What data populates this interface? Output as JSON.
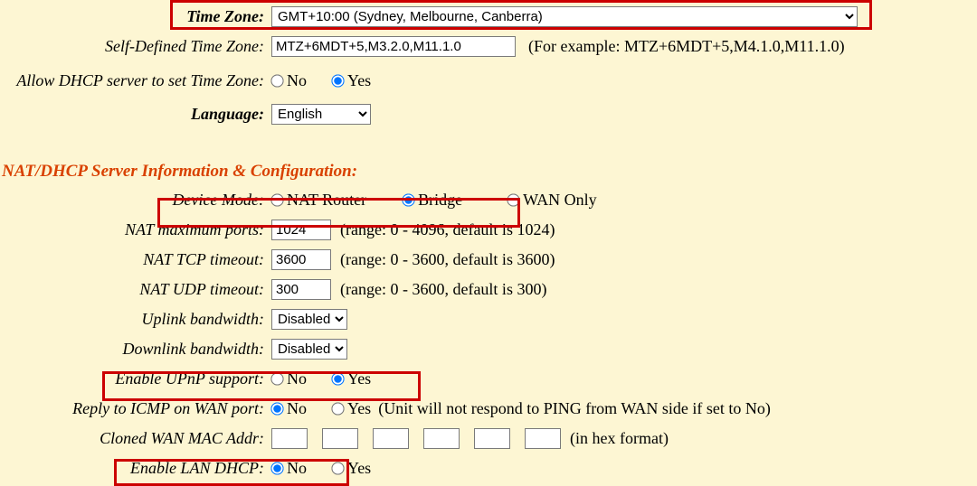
{
  "timezone": {
    "label": "Time Zone:",
    "value": "GMT+10:00 (Sydney, Melbourne, Canberra)"
  },
  "self_tz": {
    "label": "Self-Defined Time Zone:",
    "value": "MTZ+6MDT+5,M3.2.0,M11.1.0",
    "hint": "(For example: MTZ+6MDT+5,M4.1.0,M11.1.0)"
  },
  "dhcp_tz": {
    "label": "Allow DHCP server to set Time Zone:",
    "no": "No",
    "yes": "Yes"
  },
  "language": {
    "label": "Language:",
    "value": "English"
  },
  "section_nat": "NAT/DHCP Server Information & Configuration:",
  "device_mode": {
    "label": "Device Mode:",
    "nat": "NAT Router",
    "bridge": "Bridge",
    "wan": "WAN Only"
  },
  "nat_max": {
    "label": "NAT maximum ports:",
    "value": "1024",
    "hint": "(range: 0 - 4096, default is 1024)"
  },
  "nat_tcp": {
    "label": "NAT TCP timeout:",
    "value": "3600",
    "hint": "(range: 0 - 3600, default is 3600)"
  },
  "nat_udp": {
    "label": "NAT UDP timeout:",
    "value": "300",
    "hint": "(range: 0 - 3600, default is 300)"
  },
  "uplink": {
    "label": "Uplink bandwidth:",
    "value": "Disabled"
  },
  "downlink": {
    "label": "Downlink bandwidth:",
    "value": "Disabled"
  },
  "upnp": {
    "label": "Enable UPnP support:",
    "no": "No",
    "yes": "Yes"
  },
  "icmp": {
    "label": "Reply to ICMP on WAN port:",
    "no": "No",
    "yes": "Yes",
    "hint": "(Unit will not respond to PING from WAN side if set to No)"
  },
  "mac": {
    "label": "Cloned WAN MAC Addr:",
    "hint": "(in hex format)"
  },
  "lan_dhcp": {
    "label": "Enable LAN DHCP:",
    "no": "No",
    "yes": "Yes"
  }
}
